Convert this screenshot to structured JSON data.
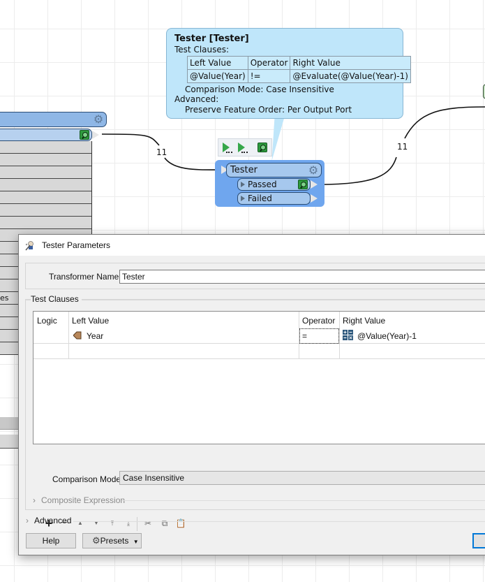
{
  "canvas": {
    "left_node": {
      "output_port_partial_label": "es"
    },
    "links": [
      {
        "name": "link-to-tester",
        "count": "11"
      },
      {
        "name": "link-from-passed",
        "count": "11"
      }
    ],
    "tooltip": {
      "title": "Tester [Tester]",
      "test_clauses_label": "Test Clauses:",
      "table": {
        "headers": [
          "Left Value",
          "Operator",
          "Right Value"
        ],
        "rows": [
          [
            "@Value(Year)",
            "!=",
            "@Evaluate(@Value(Year)-1)"
          ]
        ]
      },
      "comparison_mode_line": "Comparison Mode: Case Insensitive",
      "advanced_label": "Advanced:",
      "preserve_order_line": "Preserve Feature Order: Per Output Port"
    },
    "node_toolbar": {
      "icons": [
        "run-to-this-icon",
        "run-from-this-icon",
        "inspect-icon"
      ]
    },
    "tester_node": {
      "name": "Tester",
      "ports": [
        {
          "label": "Passed",
          "has_inspector": true
        },
        {
          "label": "Failed",
          "has_inspector": false
        }
      ]
    },
    "colors": {
      "node_blue": "#6fa6ee",
      "port_blue": "#a6c8ee",
      "tooltip_bg": "#bfe6fa",
      "inspector_green": "#2e9a3e"
    }
  },
  "dialog": {
    "title": "Tester Parameters",
    "transformer_name_label": "Transformer Name:",
    "transformer_name_value": "Tester",
    "test_clauses_group": "Test Clauses",
    "table": {
      "headers": [
        "Logic",
        "Left Value",
        "Operator",
        "Right Value"
      ],
      "rows": [
        {
          "logic": "",
          "left_value": "Year",
          "left_value_icon": "attribute-icon",
          "operator": "=",
          "right_value": "@Value(Year)-1",
          "right_value_icon": "arithmetic-editor-icon"
        },
        {
          "logic": "",
          "left_value": "",
          "operator": "",
          "right_value": ""
        }
      ]
    },
    "toolbar": {
      "buttons": [
        "add",
        "remove",
        "move-up",
        "move-down",
        "move-to-top",
        "move-to-bottom",
        "cut",
        "copy",
        "paste"
      ]
    },
    "comparison_mode_label": "Comparison Mode:",
    "comparison_mode_value": "Case Insensitive",
    "composite_expression_label": "Composite Expression",
    "advanced_label": "Advanced",
    "help_button": "Help",
    "presets_button": "Presets",
    "accent_color": "#0078d7"
  }
}
